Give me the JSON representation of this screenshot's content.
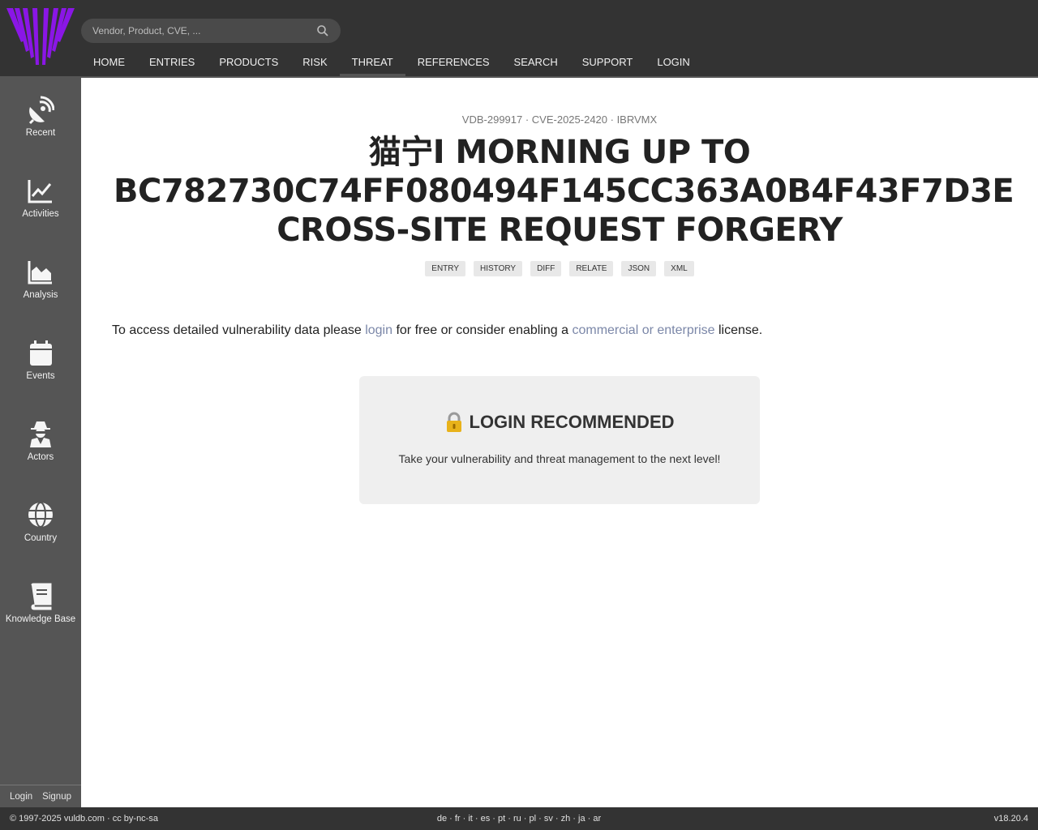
{
  "search": {
    "placeholder": "Vendor, Product, CVE, ..."
  },
  "nav": [
    "HOME",
    "ENTRIES",
    "PRODUCTS",
    "RISK",
    "THREAT",
    "REFERENCES",
    "SEARCH",
    "SUPPORT",
    "LOGIN"
  ],
  "nav_active": "THREAT",
  "sidebar": {
    "items": [
      {
        "label": "Recent",
        "icon": "satellite-dish-icon"
      },
      {
        "label": "Activities",
        "icon": "line-chart-icon"
      },
      {
        "label": "Analysis",
        "icon": "area-chart-icon"
      },
      {
        "label": "Events",
        "icon": "calendar-icon"
      },
      {
        "label": "Actors",
        "icon": "user-secret-icon"
      },
      {
        "label": "Country",
        "icon": "globe-icon"
      },
      {
        "label": "Knowledge Base",
        "icon": "book-icon"
      }
    ],
    "login": "Login",
    "signup": "Signup"
  },
  "entry": {
    "meta": "VDB-299917 · CVE-2025-2420 · IBRVMX",
    "title": "猫宁I MORNING UP TO BC782730C74FF080494F145CC363A0B4F43F7D3E CROSS-SITE REQUEST FORGERY",
    "tabs": [
      "ENTRY",
      "HISTORY",
      "DIFF",
      "RELATE",
      "JSON",
      "XML"
    ]
  },
  "notice": {
    "before": "To access detailed vulnerability data please ",
    "login_link": "login",
    "middle": " for free or consider enabling a ",
    "license_link": "commercial or enterprise",
    "after": " license."
  },
  "loginbox": {
    "icon": "lock-icon",
    "heading": "LOGIN RECOMMENDED",
    "text": "Take your vulnerability and threat management to the next level!"
  },
  "footer": {
    "copyright": "© 1997-2025 vuldb.com · cc by-nc-sa",
    "languages": "de · fr · it · es · pt · ru · pl · sv · zh · ja · ar",
    "version": "v18.20.4"
  },
  "colors": {
    "topbar": "#333333",
    "sidebar": "#555555",
    "logo": "#8a16e6",
    "link": "#7b87a8",
    "box": "#efefef"
  }
}
